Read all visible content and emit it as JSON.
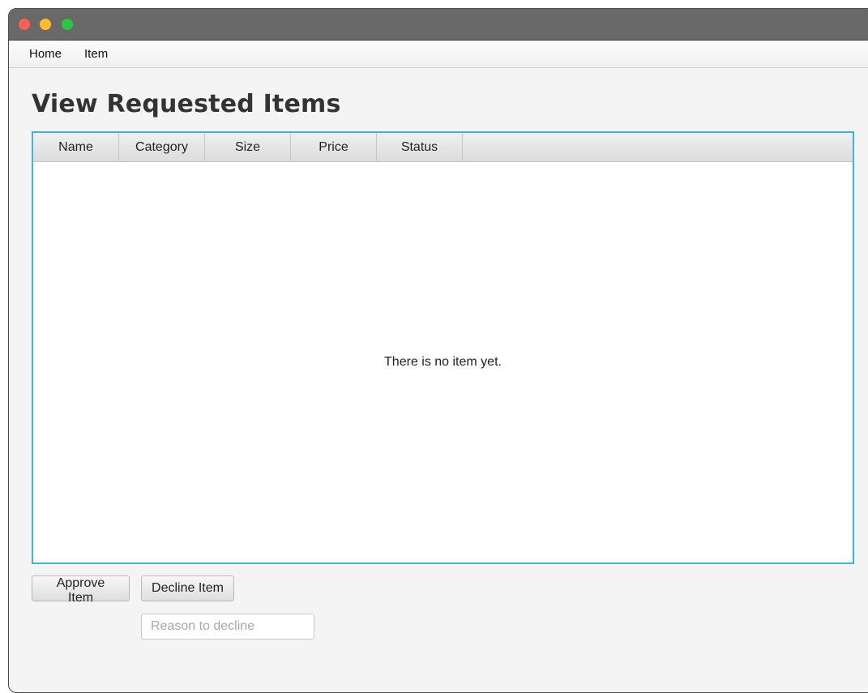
{
  "window": {
    "controls": {
      "close_color": "#fe5f57",
      "minimize_color": "#febc2e",
      "maximize_color": "#28c840"
    }
  },
  "menu": {
    "items": [
      {
        "label": "Home"
      },
      {
        "label": "Item"
      }
    ]
  },
  "page": {
    "title": "View Requested Items"
  },
  "table": {
    "columns": [
      "Name",
      "Category",
      "Size",
      "Price",
      "Status"
    ],
    "rows": [],
    "empty_message": "There is no item yet.",
    "focus_border_color": "#3bb6e1"
  },
  "actions": {
    "approve_label": "Approve Item",
    "decline_label": "Decline Item"
  },
  "reason_field": {
    "value": "",
    "placeholder": "Reason to decline"
  }
}
